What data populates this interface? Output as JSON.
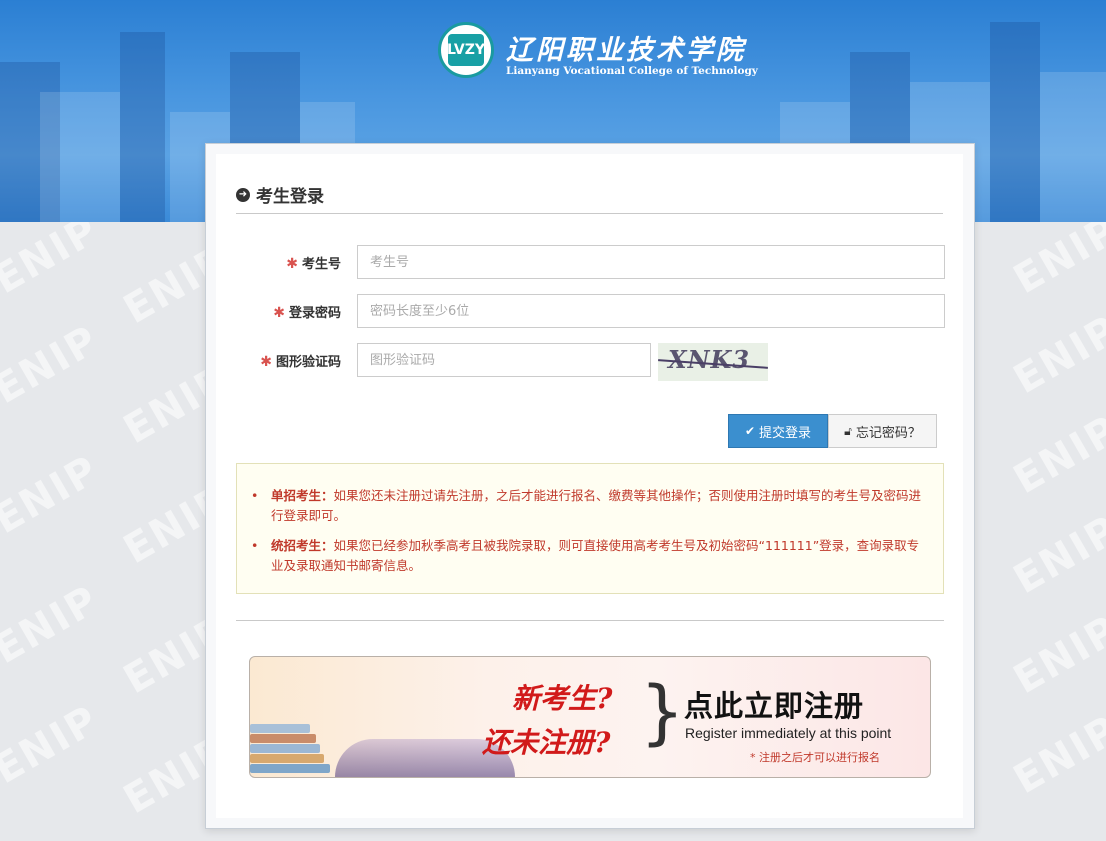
{
  "colors": {
    "banner": "#3a8ad8",
    "accent": "#3b8fcf",
    "required_star": "#d9534f",
    "notice_text": "#c0392b",
    "register_red": "#d11a1a"
  },
  "header": {
    "logo_badge_text": "LVZY",
    "college_name_cn": "辽阳职业技术学院",
    "college_name_en": "Lianyang Vocational College of Technology"
  },
  "watermark_text": "ENIP",
  "login": {
    "title": "考生登录",
    "title_icon": "circle-arrow-right-icon",
    "fields": {
      "exam_no": {
        "label": "考生号",
        "placeholder": "考生号",
        "value": ""
      },
      "password": {
        "label": "登录密码",
        "placeholder": "密码长度至少6位",
        "value": ""
      },
      "captcha": {
        "label": "图形验证码",
        "placeholder": "图形验证码",
        "value": ""
      }
    },
    "captcha_image_text": "XNK3",
    "submit_label": "提交登录",
    "submit_icon": "check-icon",
    "forgot_label": "忘记密码？",
    "forgot_icon": "lock-icon"
  },
  "notice": {
    "items": [
      {
        "title": "单招考生：",
        "text": "如果您还未注册过请先注册，之后才能进行报名、缴费等其他操作；否则使用注册时填写的考生号及密码进行登录即可。"
      },
      {
        "title": "统招考生：",
        "text": "如果您已经参加秋季高考且被我院录取，则可直接使用高考考生号及初始密码“111111”登录，查询录取专业及录取通知书邮寄信息。"
      }
    ]
  },
  "register_banner": {
    "line1": "新考生?",
    "line2": "还未注册?",
    "cta_cn": "点此立即注册",
    "cta_en": "Register immediately at this point",
    "note": "* 注册之后才可以进行报名"
  }
}
